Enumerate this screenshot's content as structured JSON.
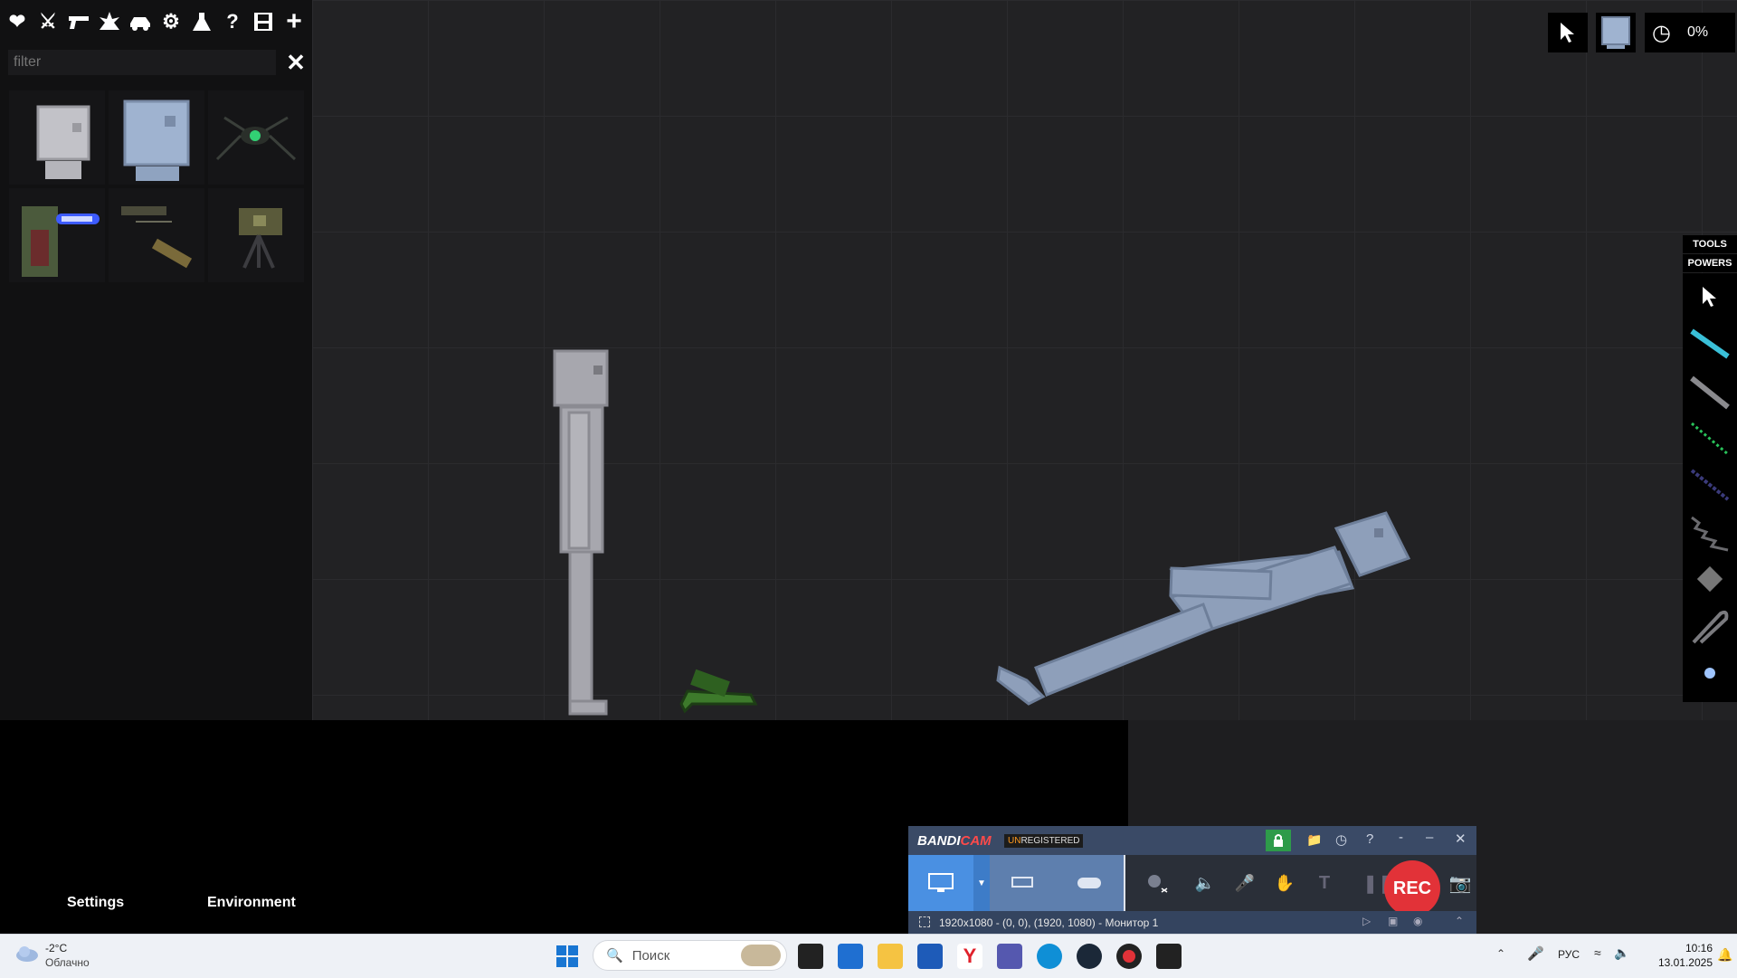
{
  "toolbar": {
    "icons": [
      "heart-icon",
      "melee-icon",
      "firearm-icon",
      "explosive-icon",
      "vehicle-icon",
      "machinery-icon",
      "chemistry-icon",
      "help-icon",
      "save-icon",
      "add-icon"
    ],
    "filter_placeholder": "filter"
  },
  "items_panel": {
    "items": [
      "human-item",
      "android-item",
      "spider-creature-item",
      "siren-machine-item",
      "weapon-parts-item",
      "turret-item"
    ]
  },
  "top_right": {
    "time_scale": "0%"
  },
  "right_panel": {
    "tabs": [
      "TOOLS",
      "POWERS"
    ],
    "tools": [
      "cursor-tool",
      "laser-tool",
      "rod-tool",
      "spring-tool",
      "rope-tool",
      "chain-tool",
      "fixed-tool",
      "cable-tool",
      "spark-tool"
    ]
  },
  "bottom_menu": {
    "settings": "Settings",
    "environment": "Environment"
  },
  "bandicam": {
    "logo_bandi": "BANDI",
    "logo_cam": "CAM",
    "badge_un": "UN",
    "badge_rest": "REGISTERED",
    "rec": "REC",
    "status": "1920x1080 - (0, 0), (1920, 1080) - Монитор 1"
  },
  "taskbar": {
    "weather_temp": "-2°C",
    "weather_condition": "Облачно",
    "search_placeholder": "Поиск",
    "language": "РУС",
    "time": "10:16",
    "date": "13.01.2025"
  },
  "colors": {
    "viewport_bg": "#222224",
    "ragdoll_gray": "#a7a7ae",
    "ragdoll_blue": "#8e9fba",
    "rec_red": "#e23238",
    "bandicam_blue": "#4a90e2"
  }
}
